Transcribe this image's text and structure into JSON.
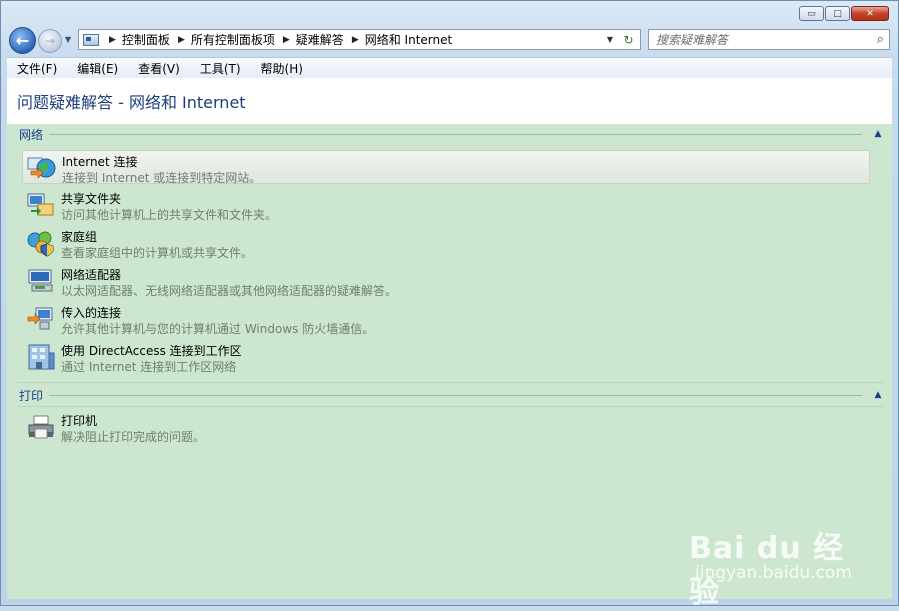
{
  "window": {
    "minimize": "▭",
    "maximize": "□",
    "close": "✕"
  },
  "address": {
    "breadcrumbs": [
      "控制面板",
      "所有控制面板项",
      "疑难解答",
      "网络和 Internet"
    ]
  },
  "search": {
    "placeholder": "搜索疑难解答"
  },
  "menu": [
    "文件(F)",
    "编辑(E)",
    "查看(V)",
    "工具(T)",
    "帮助(H)"
  ],
  "page": {
    "title": "问题疑难解答 - 网络和 Internet"
  },
  "groups": [
    {
      "title": "网络",
      "items": [
        {
          "title": "Internet 连接",
          "desc": "连接到 Internet 或连接到特定网站。",
          "icon": "globe-network-icon",
          "selected": true
        },
        {
          "title": "共享文件夹",
          "desc": "访问其他计算机上的共享文件和文件夹。",
          "icon": "shared-folder-icon"
        },
        {
          "title": "家庭组",
          "desc": "查看家庭组中的计算机或共享文件。",
          "icon": "homegroup-icon"
        },
        {
          "title": "网络适配器",
          "desc": "以太网适配器、无线网络适配器或其他网络适配器的疑难解答。",
          "icon": "network-adapter-icon"
        },
        {
          "title": "传入的连接",
          "desc": "允许其他计算机与您的计算机通过 Windows 防火墙通信。",
          "icon": "incoming-connection-icon"
        },
        {
          "title": "使用 DirectAccess 连接到工作区",
          "desc": "通过 Internet 连接到工作区网络",
          "icon": "directaccess-icon"
        }
      ]
    },
    {
      "title": "打印",
      "items": [
        {
          "title": "打印机",
          "desc": "解决阻止打印完成的问题。",
          "icon": "printer-icon"
        }
      ]
    }
  ],
  "watermark": {
    "brand": "Bai du 经验",
    "url": "jingyan.baidu.com"
  }
}
